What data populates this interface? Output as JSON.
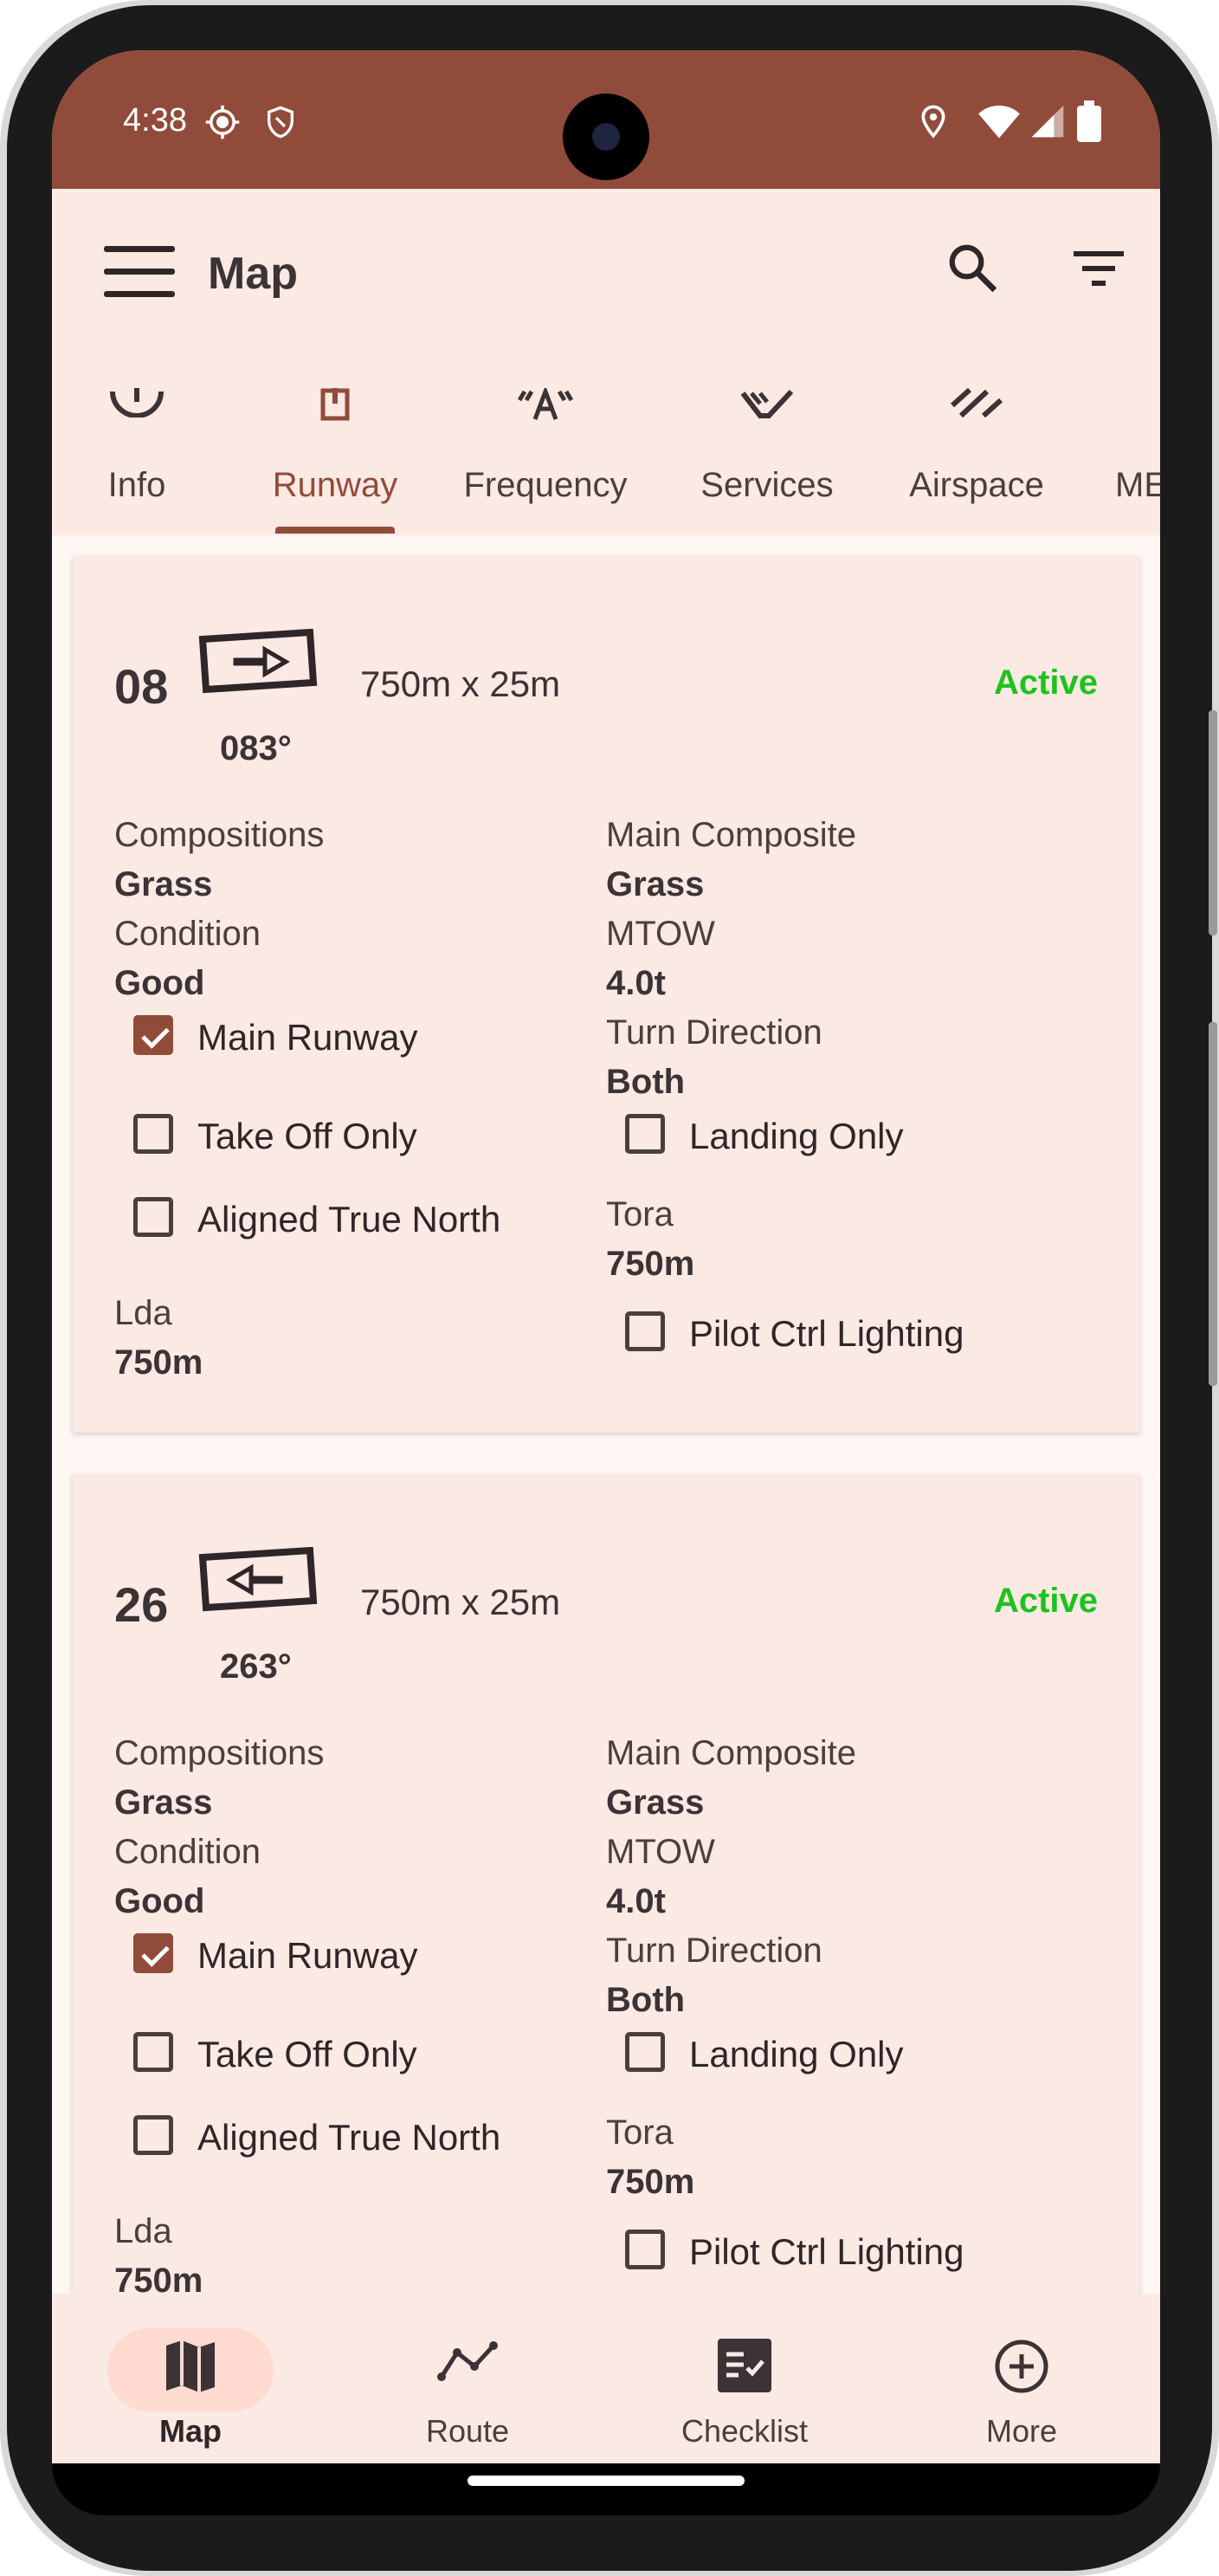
{
  "status_bar": {
    "time": "4:38"
  },
  "app_bar": {
    "title": "Map"
  },
  "tabs": [
    {
      "label": "Info",
      "icon": "info-icon"
    },
    {
      "label": "Runway",
      "icon": "runway-icon",
      "active": true
    },
    {
      "label": "Frequency",
      "icon": "frequency-icon"
    },
    {
      "label": "Services",
      "icon": "services-icon"
    },
    {
      "label": "Airspace",
      "icon": "airspace-icon"
    },
    {
      "label": "ME",
      "icon": "more-tab-icon"
    }
  ],
  "runways": [
    {
      "number": "08",
      "dimensions": "750m x 25m",
      "heading": "083°",
      "status": "Active",
      "direction": "right",
      "compositions_label": "Compositions",
      "compositions": "Grass",
      "condition_label": "Condition",
      "condition": "Good",
      "main_composite_label": "Main Composite",
      "main_composite": "Grass",
      "mtow_label": "MTOW",
      "mtow": "4.0t",
      "turn_direction_label": "Turn Direction",
      "turn_direction": "Both",
      "tora_label": "Tora",
      "tora": "750m",
      "lda_label": "Lda",
      "lda": "750m",
      "main_runway_label": "Main Runway",
      "main_runway": true,
      "take_off_only_label": "Take Off Only",
      "take_off_only": false,
      "aligned_true_north_label": "Aligned True North",
      "aligned_true_north": false,
      "landing_only_label": "Landing Only",
      "landing_only": false,
      "pilot_ctrl_lighting_label": "Pilot Ctrl Lighting",
      "pilot_ctrl_lighting": false
    },
    {
      "number": "26",
      "dimensions": "750m x 25m",
      "heading": "263°",
      "status": "Active",
      "direction": "left",
      "compositions_label": "Compositions",
      "compositions": "Grass",
      "condition_label": "Condition",
      "condition": "Good",
      "main_composite_label": "Main Composite",
      "main_composite": "Grass",
      "mtow_label": "MTOW",
      "mtow": "4.0t",
      "turn_direction_label": "Turn Direction",
      "turn_direction": "Both",
      "tora_label": "Tora",
      "tora": "750m",
      "lda_label": "Lda",
      "lda": "750m",
      "main_runway_label": "Main Runway",
      "main_runway": true,
      "take_off_only_label": "Take Off Only",
      "take_off_only": false,
      "aligned_true_north_label": "Aligned True North",
      "aligned_true_north": false,
      "landing_only_label": "Landing Only",
      "landing_only": false,
      "pilot_ctrl_lighting_label": "Pilot Ctrl Lighting",
      "pilot_ctrl_lighting": false
    }
  ],
  "bottom_nav": [
    {
      "label": "Map",
      "icon": "map-icon",
      "active": true
    },
    {
      "label": "Route",
      "icon": "route-icon"
    },
    {
      "label": "Checklist",
      "icon": "checklist-icon"
    },
    {
      "label": "More",
      "icon": "add-circle-icon"
    }
  ],
  "colors": {
    "brand": "#914b3a",
    "active_status": "#1ec21e",
    "surface": "#fbe9e3"
  }
}
